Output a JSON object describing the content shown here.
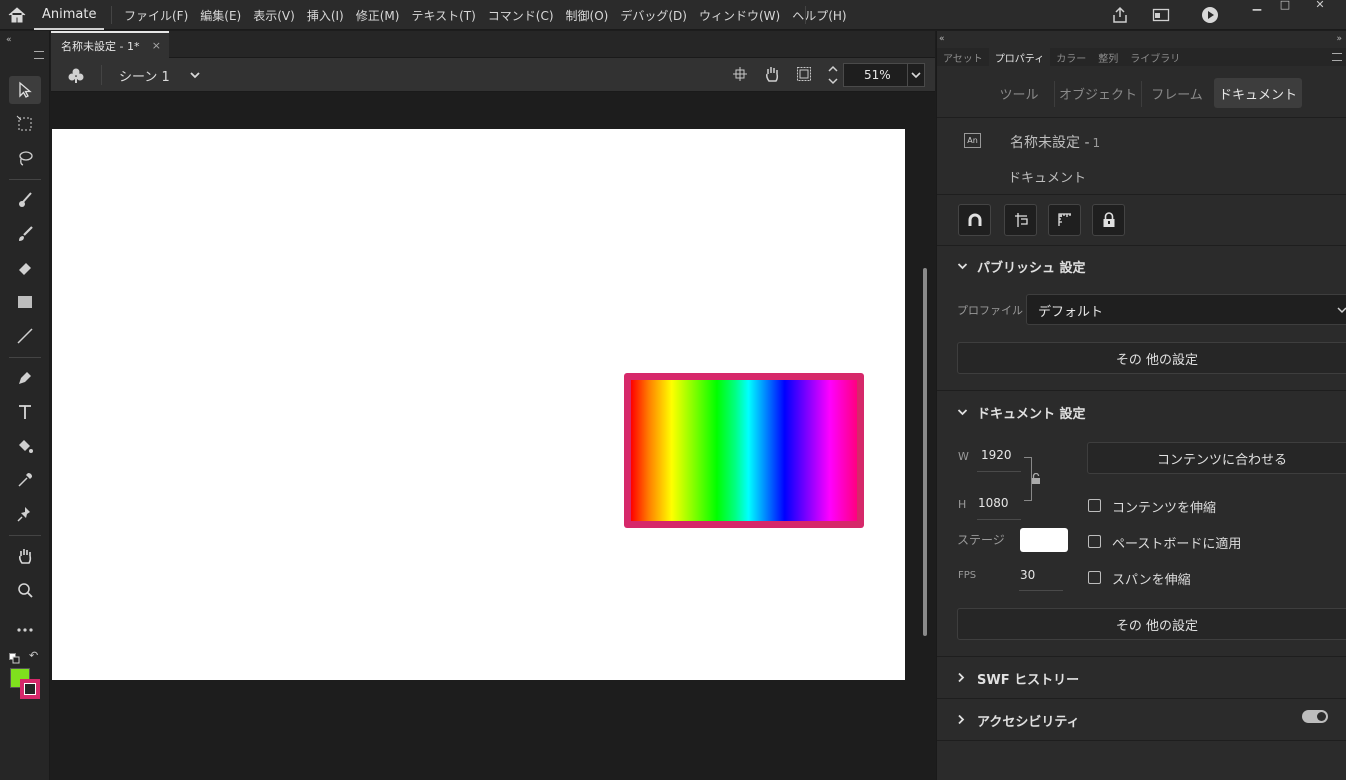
{
  "app": {
    "tab": "Animate"
  },
  "menu": [
    "ファイル(F)",
    "編集(E)",
    "表示(V)",
    "挿入(I)",
    "修正(M)",
    "テキスト(T)",
    "コマンド(C)",
    "制御(O)",
    "デバッグ(D)",
    "ウィンドウ(W)",
    "ヘルプ(H)"
  ],
  "document": {
    "tab_title": "名称未設定 - 1*",
    "close_glyph": "×"
  },
  "scene": {
    "label": "シーン 1",
    "zoom": "51%"
  },
  "panel": {
    "tabs": [
      "アセット",
      "プロパティ",
      "カラー",
      "整列",
      "ライブラリ"
    ],
    "active_tab": "プロパティ",
    "subtabs": [
      "ツール",
      "オブジェクト",
      "フレーム",
      "ドキュメント"
    ],
    "active_subtab": "ドキュメント",
    "doc_name": "名称未設定 -",
    "doc_num": "1",
    "doc_kind": "ドキュメント",
    "doc_icon_text": "An",
    "publish": {
      "title": "パブリッシュ 設定",
      "profile_label": "プロファイル",
      "profile_value": "デフォルト",
      "more_button": "その 他の設定"
    },
    "doc_settings": {
      "title": "ドキュメント 設定",
      "w_label": "W",
      "w_value": "1920",
      "h_label": "H",
      "h_value": "1080",
      "fit_button": "コンテンツに合わせる",
      "scale_content": "コンテンツを伸縮",
      "apply_pasteboard": "ペーストボードに適用",
      "scale_spans": "スパンを伸縮",
      "stage_label": "ステージ",
      "stage_color": "#ffffff",
      "fps_label": "FPS",
      "fps_value": "30",
      "more_button": "その 他の設定"
    },
    "swf_history": "SWF ヒストリー",
    "accessibility": "アクセシビリティ"
  },
  "colors": {
    "fill": "#7fe01e",
    "stroke": "#d6286a",
    "stage_bg": "#ffffff"
  }
}
